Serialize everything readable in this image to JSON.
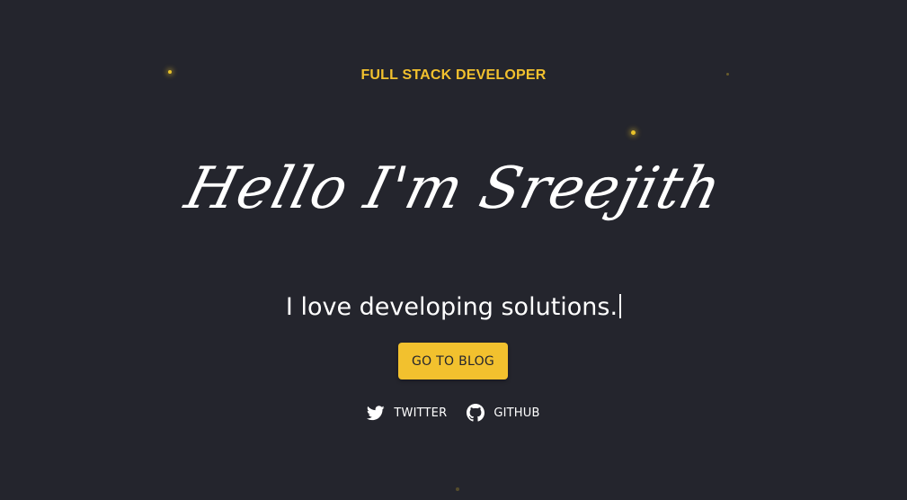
{
  "hero": {
    "role": "FULL STACK DEVELOPER",
    "greeting": "Hello I'm Sreejith",
    "tagline": "I love developing solutions.",
    "cta_label": "GO TO BLOG"
  },
  "socials": [
    {
      "label": "TWITTER",
      "icon": "twitter-icon"
    },
    {
      "label": "GITHUB",
      "icon": "github-icon"
    }
  ],
  "colors": {
    "background": "#24252d",
    "accent": "#f2c12e",
    "text": "#ffffff"
  }
}
